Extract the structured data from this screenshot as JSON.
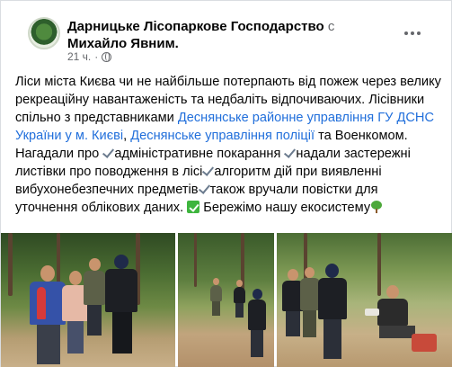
{
  "post": {
    "author": "Дарницьке Лісопаркове Господарство",
    "with_word": "с",
    "with_person": "Михайло Явним",
    "author_suffix": ".",
    "time": "21 ч.",
    "more_label": "···",
    "text": {
      "s1": "Ліси міста Києва чи не найбільше потерпають від пожеж через велику рекреаційну навантаженість та недбаліть відпочиваючих.",
      "s2": "Лісівники спільно з представниками",
      "link1": "Деснянське районне управління ГУ ДСНС України у м. Києві",
      "s3": ",",
      "link2": "Деснянське управління поліції",
      "s4": "та Военкомом. Нагадали про",
      "s5": "адміністративне покарання",
      "s6": "надали застережні листівки про поводження в лісі",
      "s7": "алгоритм дій при виявленні вибухонебезпечних предметів",
      "s8": "також вручали повістки для уточнення облікових даних.",
      "s9": "Бережімо нашу екосистему"
    },
    "icons": {
      "avatar": "forest-logo-icon",
      "privacy": "globe-icon",
      "more": "more-horizontal-icon",
      "check": "check-mark-icon",
      "check_box": "green-check-box-icon",
      "tree": "tree-icon"
    },
    "colors": {
      "link": "#216fdb",
      "text": "#050505",
      "meta": "#65676b"
    }
  }
}
